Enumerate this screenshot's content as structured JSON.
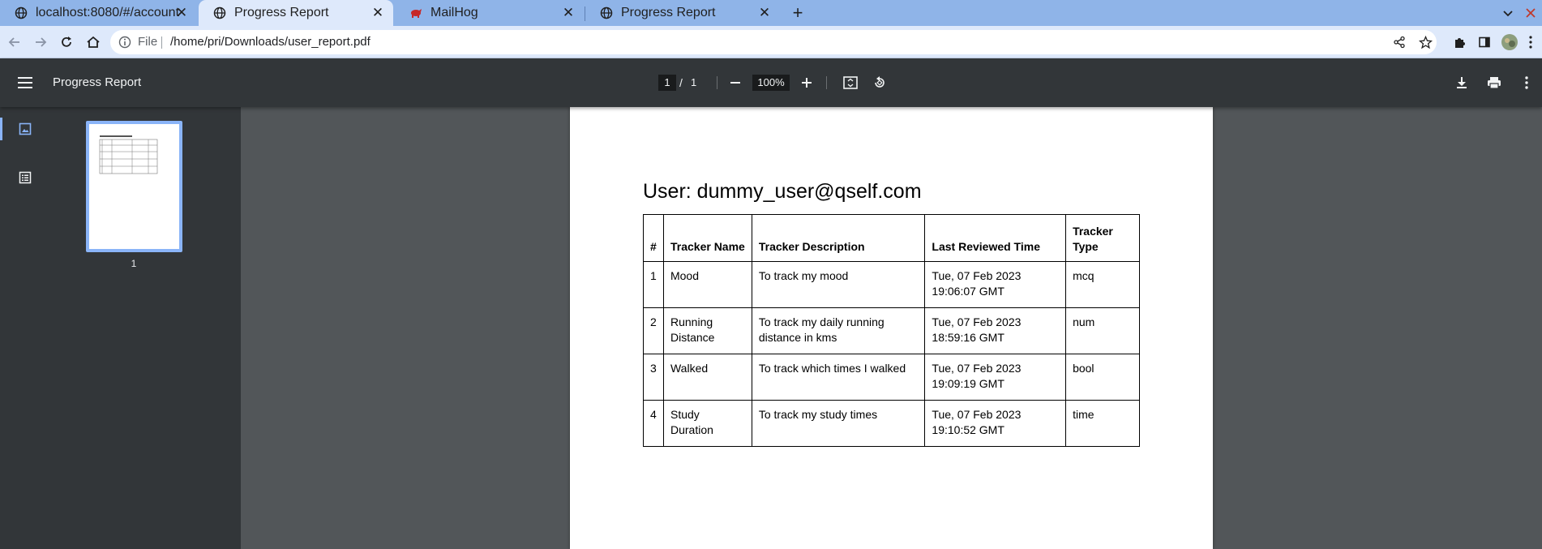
{
  "browser": {
    "tabs": [
      {
        "title": "localhost:8080/#/account",
        "icon": "globe-icon",
        "active": false
      },
      {
        "title": "Progress Report",
        "icon": "globe-icon",
        "active": true
      },
      {
        "title": "MailHog",
        "icon": "mailhog-icon",
        "active": false
      },
      {
        "title": "Progress Report",
        "icon": "globe-icon",
        "active": false
      }
    ],
    "address": {
      "scheme_label": "File",
      "url": "/home/pri/Downloads/user_report.pdf"
    }
  },
  "pdf_viewer": {
    "title": "Progress Report",
    "current_page": "1",
    "page_separator": "/",
    "total_pages": "1",
    "zoom": "100%",
    "thumbnail_page_number": "1"
  },
  "report": {
    "title": "User: dummy_user@qself.com",
    "columns": [
      "#",
      "Tracker Name",
      "Tracker Description",
      "Last Reviewed Time",
      "Tracker\nType"
    ],
    "rows": [
      [
        "1",
        "Mood",
        "To track my mood",
        "Tue, 07 Feb 2023\n19:06:07 GMT",
        "mcq"
      ],
      [
        "2",
        "Running\nDistance",
        "To track my daily running\ndistance in kms",
        "Tue, 07 Feb 2023\n18:59:16 GMT",
        "num"
      ],
      [
        "3",
        "Walked",
        "To track which times I walked",
        "Tue, 07 Feb 2023\n19:09:19 GMT",
        "bool"
      ],
      [
        "4",
        "Study Duration",
        "To track my study times",
        "Tue, 07 Feb 2023\n19:10:52 GMT",
        "time"
      ]
    ]
  },
  "colors": {
    "tab_strip": "#8fb4e8",
    "toolbar": "#dee9fb",
    "viewer_toolbar": "#323639",
    "viewer_background": "#525659",
    "accent": "#8ab4f8"
  }
}
